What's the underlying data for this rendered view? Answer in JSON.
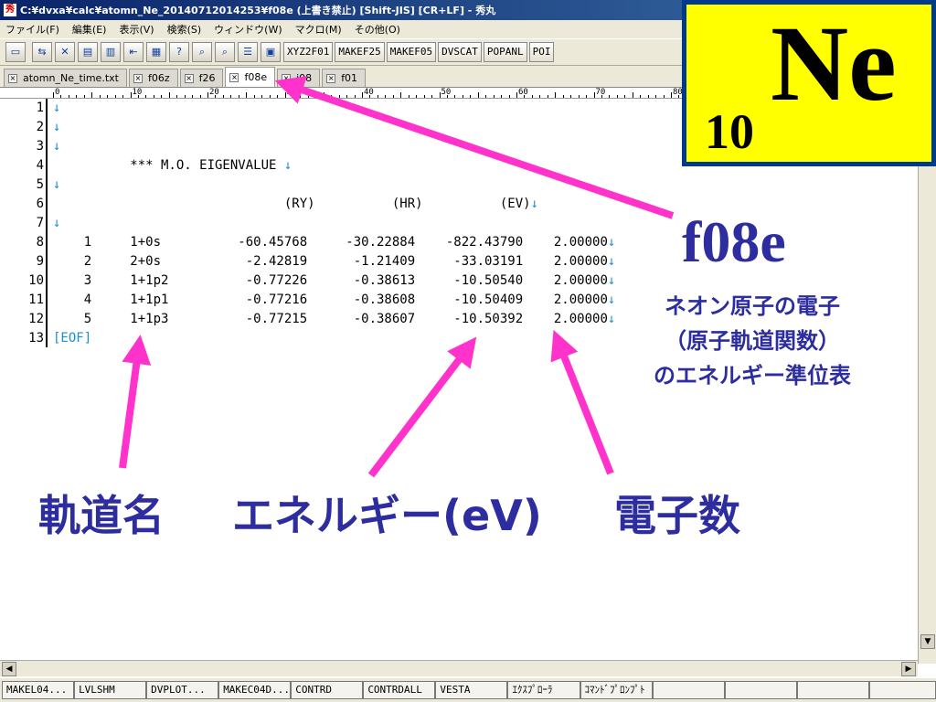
{
  "window": {
    "title": "C:¥dvxa¥calc¥atomn_Ne_20140712014253¥f08e (上書き禁止) [Shift-JIS] [CR+LF] - 秀丸"
  },
  "menu": [
    "ファイル(F)",
    "編集(E)",
    "表示(V)",
    "検索(S)",
    "ウィンドウ(W)",
    "マクロ(M)",
    "その他(O)"
  ],
  "toolbar": {
    "buttons": [
      "XYZ2F01",
      "MAKEF25",
      "MAKEF05",
      "DVSCAT",
      "POPANL",
      "POI"
    ]
  },
  "tabs": [
    {
      "label": "atomn_Ne_time.txt",
      "active": false
    },
    {
      "label": "f06z",
      "active": false
    },
    {
      "label": "f26",
      "active": false
    },
    {
      "label": "f08e",
      "active": true
    },
    {
      "label": "i08",
      "active": false
    },
    {
      "label": "f01",
      "active": false
    }
  ],
  "ruler": {
    "marks": [
      "0",
      "10",
      "20",
      "30",
      "40",
      "50",
      "60",
      "70",
      "80"
    ]
  },
  "editor": {
    "lines": [
      {
        "n": "1",
        "text": "",
        "nl": true
      },
      {
        "n": "2",
        "text": "",
        "nl": true
      },
      {
        "n": "3",
        "text": "",
        "nl": true
      },
      {
        "n": "4",
        "text": "          *** M.O. EIGENVALUE ",
        "nl": true
      },
      {
        "n": "5",
        "text": "",
        "nl": true
      },
      {
        "n": "6",
        "text": "                              (RY)          (HR)          (EV)",
        "nl": true
      },
      {
        "n": "7",
        "text": "",
        "nl": true
      },
      {
        "n": "8",
        "text": "    1     1+0s          -60.45768     -30.22884    -822.43790    2.00000",
        "nl": true
      },
      {
        "n": "9",
        "text": "    2     2+0s           -2.42819      -1.21409     -33.03191    2.00000",
        "nl": true
      },
      {
        "n": "10",
        "text": "    3     1+1p2          -0.77226      -0.38613     -10.50540    2.00000",
        "nl": true
      },
      {
        "n": "11",
        "text": "    4     1+1p1          -0.77216      -0.38608     -10.50409    2.00000",
        "nl": true
      },
      {
        "n": "12",
        "text": "    5     1+1p3          -0.77215      -0.38607     -10.50392    2.00000",
        "nl": true
      },
      {
        "n": "13",
        "text": "[EOF]",
        "nl": false
      }
    ],
    "newline_glyph": "↓"
  },
  "fkeys": [
    "MAKEL04...",
    "LVLSHM",
    "DVPLOT...",
    "MAKEC04D...",
    "CONTRD",
    "CONTRDALL",
    "VESTA",
    "ｴｸｽﾌﾟﾛｰﾗ",
    "ｺﾏﾝﾄﾞﾌﾟﾛﾝﾌﾟﾄ",
    "",
    "",
    "",
    ""
  ],
  "annotations": {
    "element_subscript": "10",
    "element_symbol": "Ne",
    "file_label": "f08e",
    "description_lines": [
      "ネオン原子の電子",
      "（原子軌道関数）",
      "のエネルギー準位表"
    ],
    "caption_orbital": "軌道名",
    "caption_energy": "エネルギー(eV)",
    "caption_electrons": "電子数",
    "arrow_color": "#ff33cc",
    "text_color": "#2d2d9f",
    "box_color": "#ffff00"
  }
}
